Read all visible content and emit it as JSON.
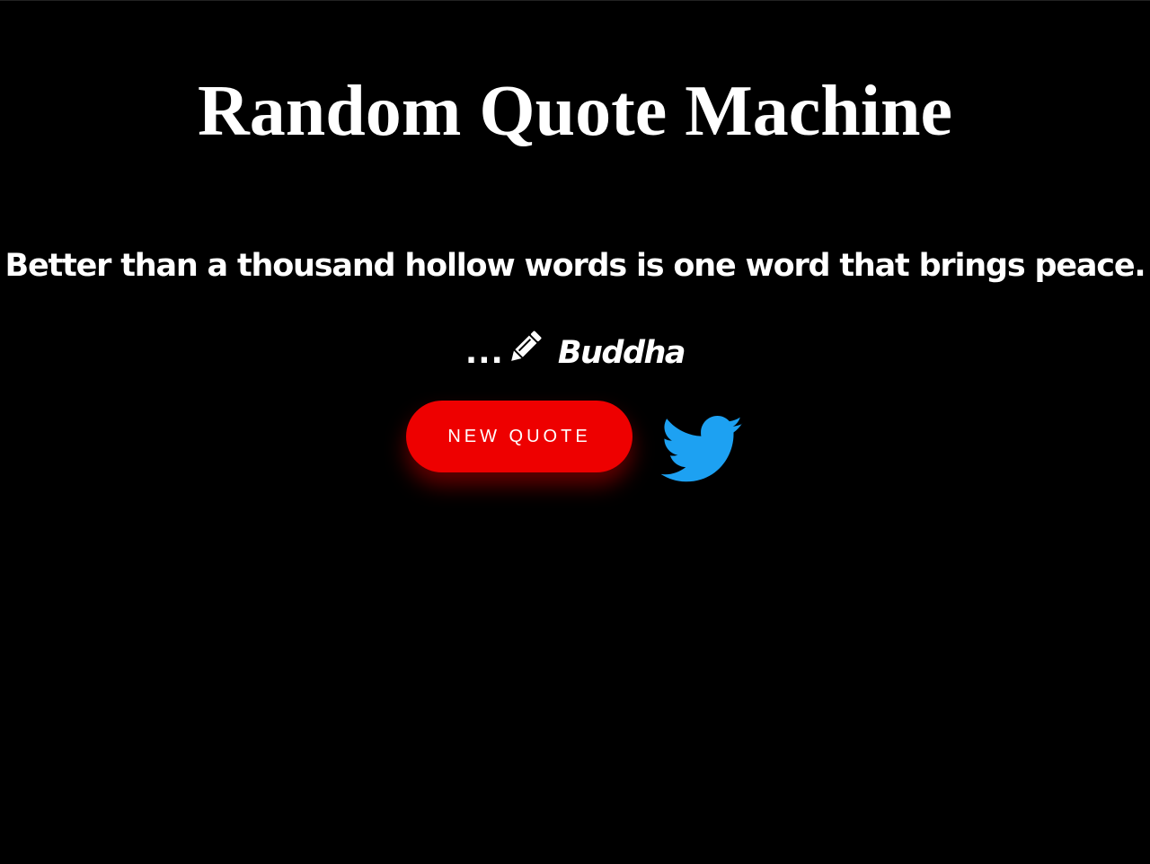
{
  "app": {
    "title": "Random Quote Machine"
  },
  "quote": {
    "text": "Better than a thousand hollow words is one word that brings peace.",
    "author_prefix": "...",
    "author": "Buddha"
  },
  "actions": {
    "new_quote_label": "New Quote"
  },
  "icons": {
    "author_icon": "pencil-icon",
    "tweet_icon": "twitter-bird-icon"
  },
  "colors": {
    "background": "#000000",
    "text": "#ffffff",
    "button": "#ee0000",
    "twitter": "#1da1f2"
  }
}
